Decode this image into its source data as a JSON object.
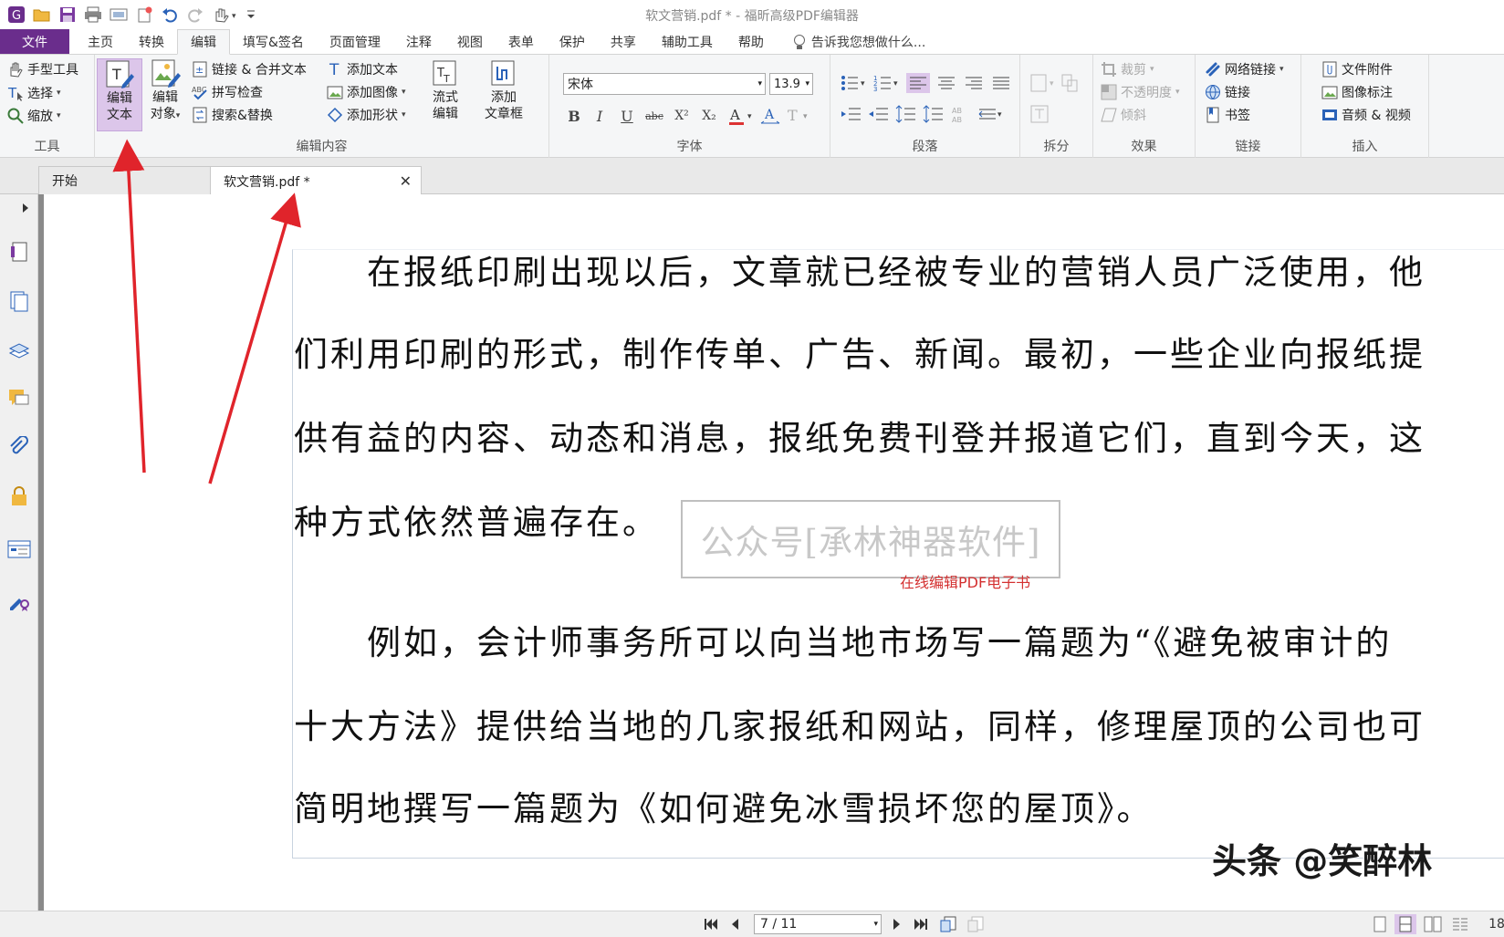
{
  "window": {
    "title": "软文营销.pdf * - 福昕高级PDF编辑器"
  },
  "menu": {
    "file": "文件",
    "tabs": [
      "主页",
      "转换",
      "编辑",
      "填写&签名",
      "页面管理",
      "注释",
      "视图",
      "表单",
      "保护",
      "共享",
      "辅助工具",
      "帮助"
    ],
    "active_tab": "编辑",
    "tell_me": "告诉我您想做什么..."
  },
  "ribbon": {
    "tools": {
      "label": "工具",
      "hand": "手型工具",
      "select": "选择",
      "zoom": "缩放"
    },
    "edit_content": {
      "label": "编辑内容",
      "edit_text_1": "编辑",
      "edit_text_2": "文本",
      "edit_object_1": "编辑",
      "edit_object_2": "对象",
      "link_merge": "链接 & 合并文本",
      "spell": "拼写检查",
      "search_replace": "搜索&替换",
      "add_text": "添加文本",
      "add_image": "添加图像",
      "add_shape": "添加形状",
      "flow_1": "流式",
      "flow_2": "编辑",
      "add_frame_1": "添加",
      "add_frame_2": "文章框"
    },
    "font": {
      "label": "字体",
      "family": "宋体",
      "size": "13.9"
    },
    "paragraph": {
      "label": "段落"
    },
    "split": {
      "label": "拆分"
    },
    "effects": {
      "label": "效果",
      "crop": "裁剪",
      "opacity": "不透明度",
      "skew": "倾斜"
    },
    "links": {
      "label": "链接",
      "web_link": "网络链接",
      "link": "链接",
      "bookmark": "书签"
    },
    "insert": {
      "label": "插入",
      "attachment": "文件附件",
      "image_annot": "图像标注",
      "av": "音频 & 视频"
    }
  },
  "doc_tabs": {
    "home": "开始",
    "current": "软文营销.pdf *"
  },
  "page": {
    "lines": [
      "　　在报纸印刷出现以后，文章就已经被专业的营销人员广泛使用，他",
      "们利用印刷的形式，制作传单、广告、新闻。最初，一些企业向报纸提",
      "供有益的内容、动态和消息，报纸免费刊登并报道它们，直到今天，这",
      "种方式依然普遍存在。",
      "　　例如，会计师事务所可以向当地市场写一篇题为“《避免被审计的",
      "十大方法》提供给当地的几家报纸和网站，同样，修理屋顶的公司也可",
      "简明地撰写一篇题为《如何避免冰雪损坏您的屋顶》。"
    ],
    "watermark": "公众号[承林神器软件]",
    "caption": "在线编辑PDF电子书",
    "overlay_brand": "头条 @笑醉林"
  },
  "status": {
    "page": "7 / 11",
    "zoom_fragment": "18"
  },
  "colors": {
    "file_tab": "#6a2d8c",
    "active_button": "#dcc6ea",
    "arrow": "#e0242b",
    "caption": "#d43131"
  }
}
